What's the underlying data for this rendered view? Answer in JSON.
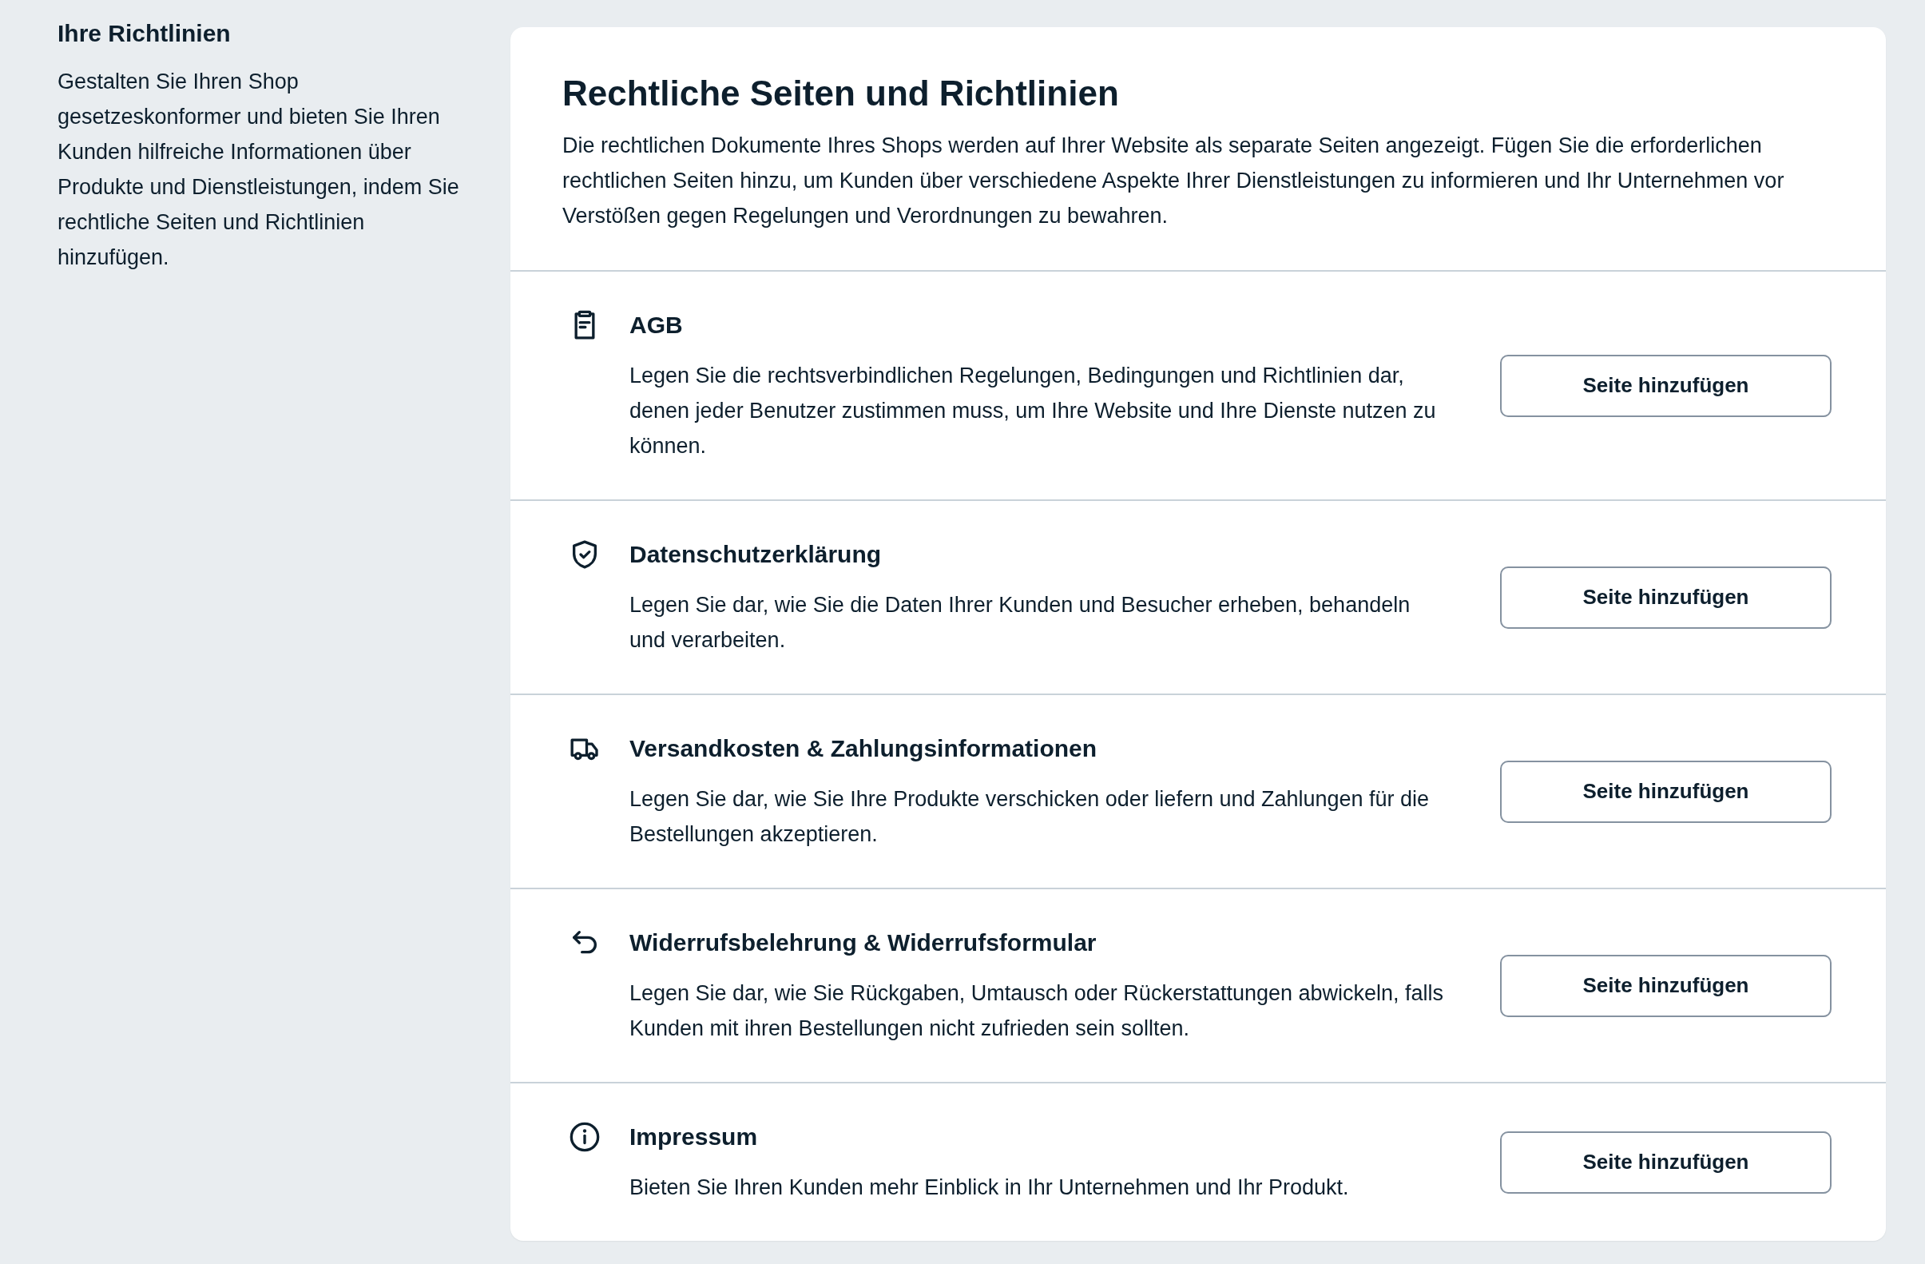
{
  "sidebar": {
    "title": "Ihre Richtlinien",
    "description": "Gestalten Sie Ihren Shop gesetzeskonformer und bieten Sie Ihren Kunden hilfreiche Informationen über Produkte und Dienstleistungen, indem Sie rechtliche Seiten und Richtlinien hinzufügen."
  },
  "card": {
    "title": "Rechtliche Seiten und Richtlinien",
    "description": "Die rechtlichen Dokumente Ihres Shops werden auf Ihrer Website als separate Seiten angezeigt. Fügen Sie die erforderlichen rechtlichen Seiten hinzu, um Kunden über verschiedene Aspekte Ihrer Dienstleistungen zu informieren und Ihr Unternehmen vor Verstößen gegen Regelungen und Verordnungen zu bewahren."
  },
  "pages": [
    {
      "kind": "terms",
      "title": "AGB",
      "description": "Legen Sie die rechtsverbindlichen Regelungen, Bedingungen und Richtlinien dar, denen jeder Benutzer zustimmen muss, um Ihre Website und Ihre Dienste nutzen zu können.",
      "button": "Seite hinzufügen"
    },
    {
      "kind": "privacy",
      "title": "Datenschutzerklärung",
      "description": "Legen Sie dar, wie Sie die Daten Ihrer Kunden und Besucher erheben, behandeln und verarbeiten.",
      "button": "Seite hinzufügen"
    },
    {
      "kind": "shipping",
      "title": "Versandkosten & Zahlungsinformationen",
      "description": "Legen Sie dar, wie Sie Ihre Produkte verschicken oder liefern und Zahlungen für die Bestellungen akzeptieren.",
      "button": "Seite hinzufügen"
    },
    {
      "kind": "returns",
      "title": "Widerrufsbelehrung & Widerrufsformular",
      "description": "Legen Sie dar, wie Sie Rückgaben, Umtausch oder Rückerstattungen abwickeln, falls Kunden mit ihren Bestellungen nicht zufrieden sein sollten.",
      "button": "Seite hinzufügen"
    },
    {
      "kind": "imprint",
      "title": "Impressum",
      "description": "Bieten Sie Ihren Kunden mehr Einblick in Ihr Unternehmen und Ihr Produkt.",
      "button": "Seite hinzufügen"
    }
  ]
}
